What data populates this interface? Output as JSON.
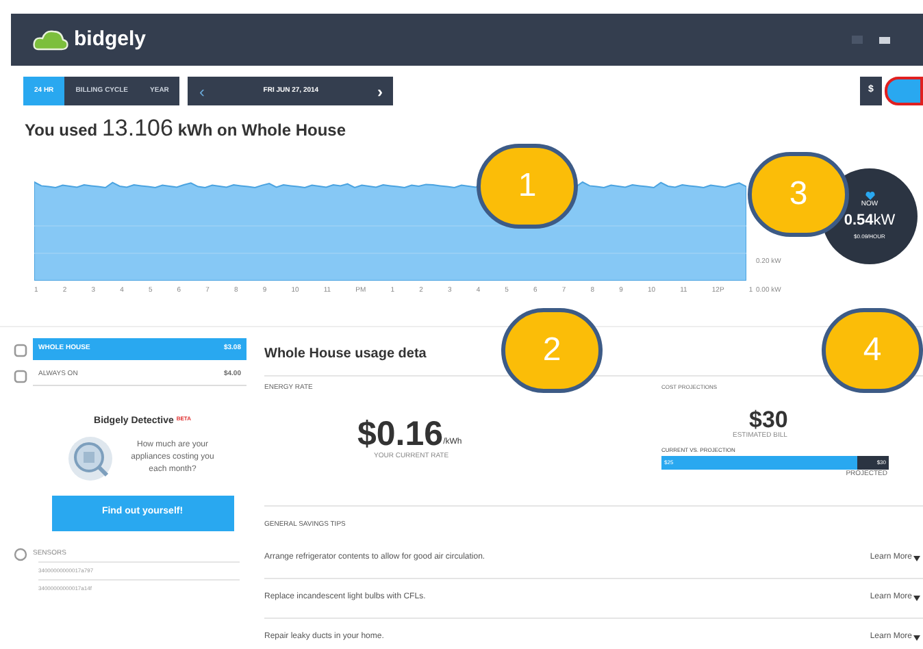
{
  "header": {
    "logo": "bidgely"
  },
  "range_tabs": [
    {
      "label": "24 HR",
      "selected": true
    },
    {
      "label": "BILLING CYCLE",
      "selected": false
    },
    {
      "label": "YEAR",
      "selected": false
    }
  ],
  "date_nav": {
    "prev": "‹",
    "date": "FRI JUN 27, 2014",
    "next": "›"
  },
  "unit_toggle": [
    {
      "label": "$",
      "selected": false
    }
  ],
  "usage_title": {
    "prefix": "You used",
    "value": "13.106",
    "unit": "kWh",
    "suffix": "on Whole House"
  },
  "chart": {
    "y_labels": [
      "0.20 kW",
      "0.00 kW"
    ],
    "x_labels": [
      "1",
      "2",
      "3",
      "4",
      "5",
      "6",
      "7",
      "8",
      "9",
      "10",
      "11",
      "PM",
      "1",
      "2",
      "3",
      "4",
      "5",
      "6",
      "7",
      "8",
      "9",
      "10",
      "11",
      "12P",
      "1"
    ]
  },
  "now_widget": {
    "label": "NOW",
    "value": "0.54",
    "unit": "kW",
    "cost": "$0.09/HOUR"
  },
  "sidebar": {
    "items": [
      {
        "label": "WHOLE HOUSE",
        "amount": "$3.08",
        "selected": true
      },
      {
        "label": "ALWAYS ON",
        "amount": "$4.00",
        "selected": false
      }
    ],
    "detective": {
      "title": "Bidgely Detective",
      "badge": "BETA",
      "text": "How much are your appliances costing you each month?",
      "button": "Find out yourself!"
    },
    "sensors": {
      "label": "SENSORS",
      "items": [
        "34000000000017a797",
        "34000000000017a14f"
      ]
    }
  },
  "details": {
    "title": "Whole House usage deta",
    "energy_rate": {
      "label": "ENERGY RATE",
      "value": "$0.16",
      "unit": "/kWh",
      "caption": "YOUR CURRENT RATE"
    },
    "cost_projections": {
      "label": "COST PROJECTIONS",
      "value": "$30",
      "caption": "ESTIMATED BILL",
      "bar_label": "CURRENT VS. PROJECTION",
      "level": 0.86,
      "current": "$25",
      "projected": "$30",
      "projected_caption": "PROJECTED"
    },
    "tips": {
      "label": "GENERAL SAVINGS TIPS",
      "items": [
        {
          "text": "Arrange refrigerator contents to allow for good air circulation.",
          "link": "Learn More"
        },
        {
          "text": "Replace incandescent light bulbs with CFLs.",
          "link": "Learn More"
        },
        {
          "text": "Repair leaky ducts in your home.",
          "link": "Learn More"
        }
      ]
    }
  },
  "annotations": [
    "1",
    "2",
    "3",
    "4"
  ]
}
